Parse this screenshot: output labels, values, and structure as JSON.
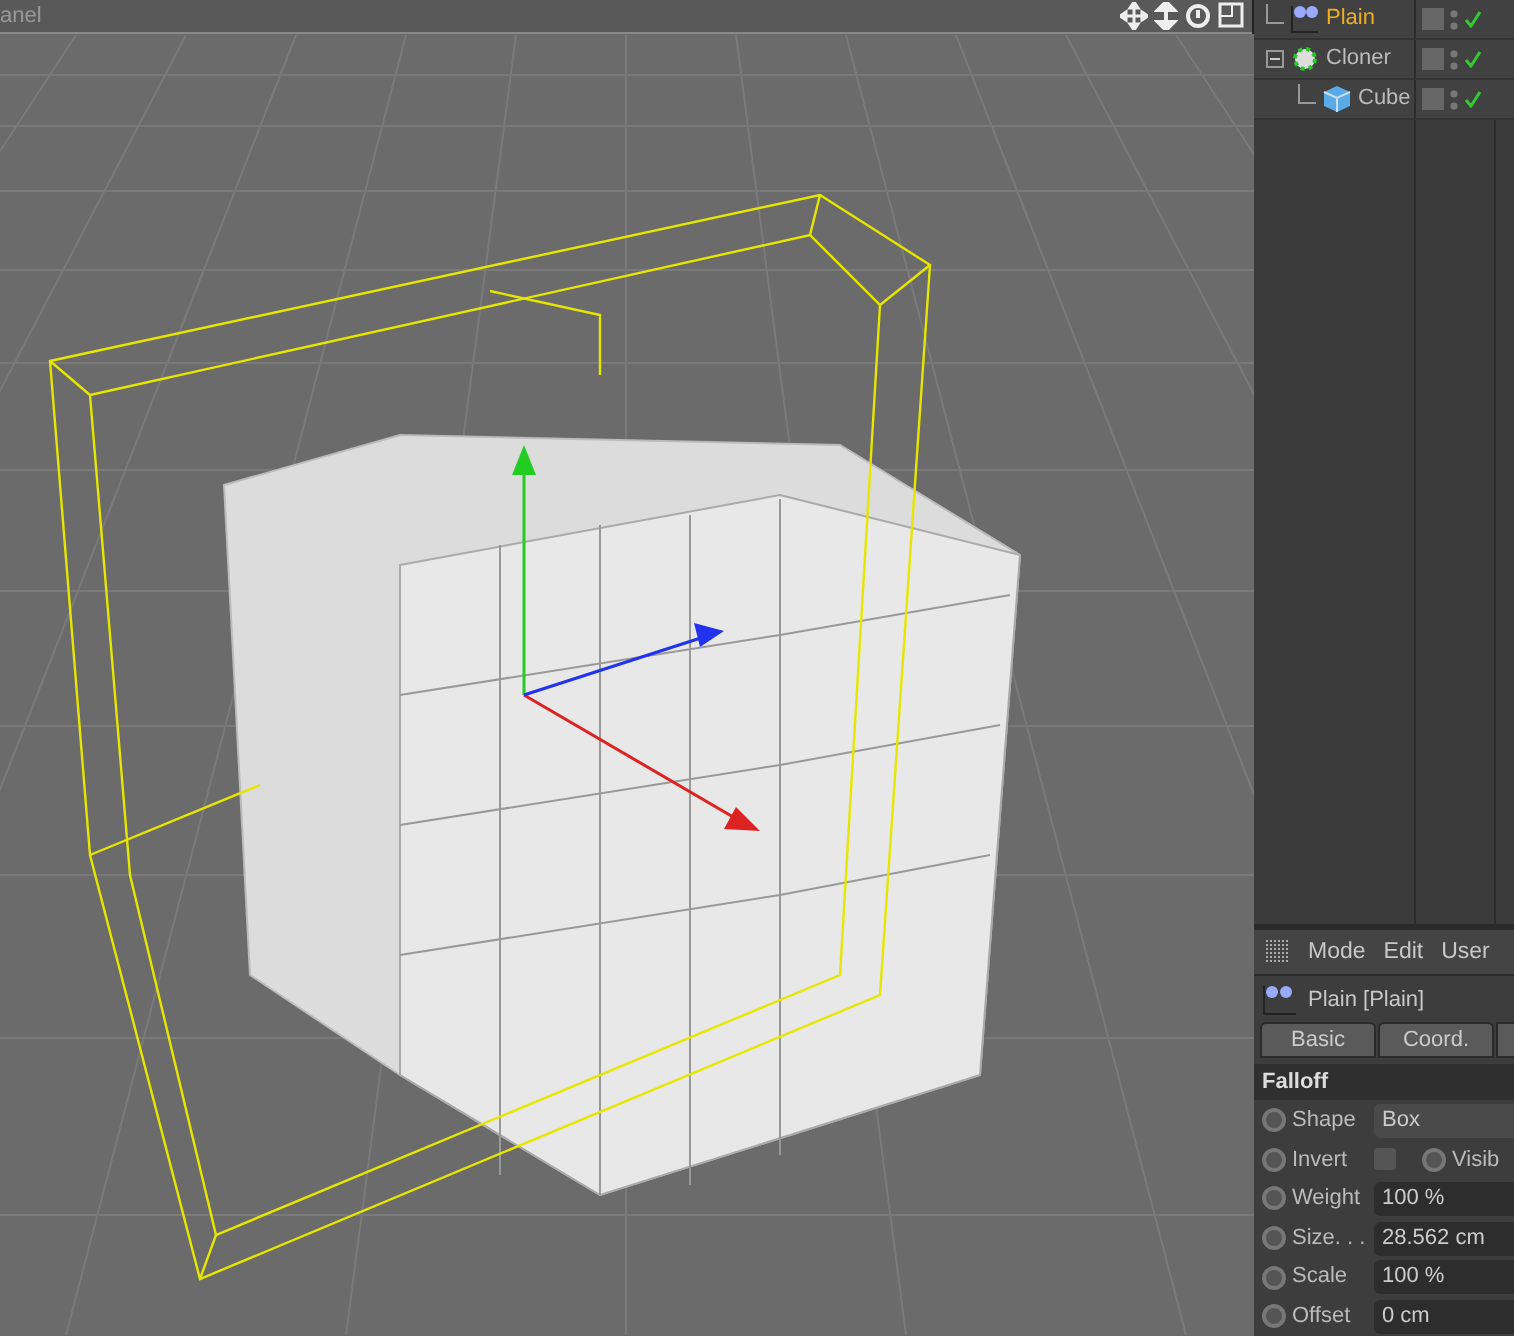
{
  "viewport": {
    "title": "anel"
  },
  "objects": [
    {
      "name": "Plain",
      "selected": true,
      "enabled": true
    },
    {
      "name": "Cloner",
      "selected": false,
      "enabled": true,
      "expanded": true,
      "children": [
        {
          "name": "Cube",
          "selected": false,
          "enabled": true
        }
      ]
    }
  ],
  "attributes": {
    "menu": [
      "Mode",
      "Edit",
      "User"
    ],
    "object_title": "Plain [Plain]",
    "tabs": [
      {
        "label": "Basic",
        "selected": false
      },
      {
        "label": "Coord.",
        "selected": false
      }
    ],
    "section": "Falloff",
    "params": [
      {
        "kind": "dropdown",
        "label": "Shape",
        "value": "Box",
        "keyframed": false
      },
      {
        "kind": "checkbox",
        "label": "Invert",
        "checked": false,
        "keyframed": false,
        "extra_label": "Visib",
        "extra_keyframed": false
      },
      {
        "kind": "number",
        "label": "Weight",
        "value": "100 %",
        "keyframed": false
      },
      {
        "kind": "number",
        "label": "Size. . .",
        "value": "28.562 cm",
        "keyframed": false
      },
      {
        "kind": "number",
        "label": "Scale",
        "value": "100 %",
        "keyframed": false
      },
      {
        "kind": "number",
        "label": "Offset",
        "value": "0 cm",
        "keyframed": false
      }
    ]
  }
}
